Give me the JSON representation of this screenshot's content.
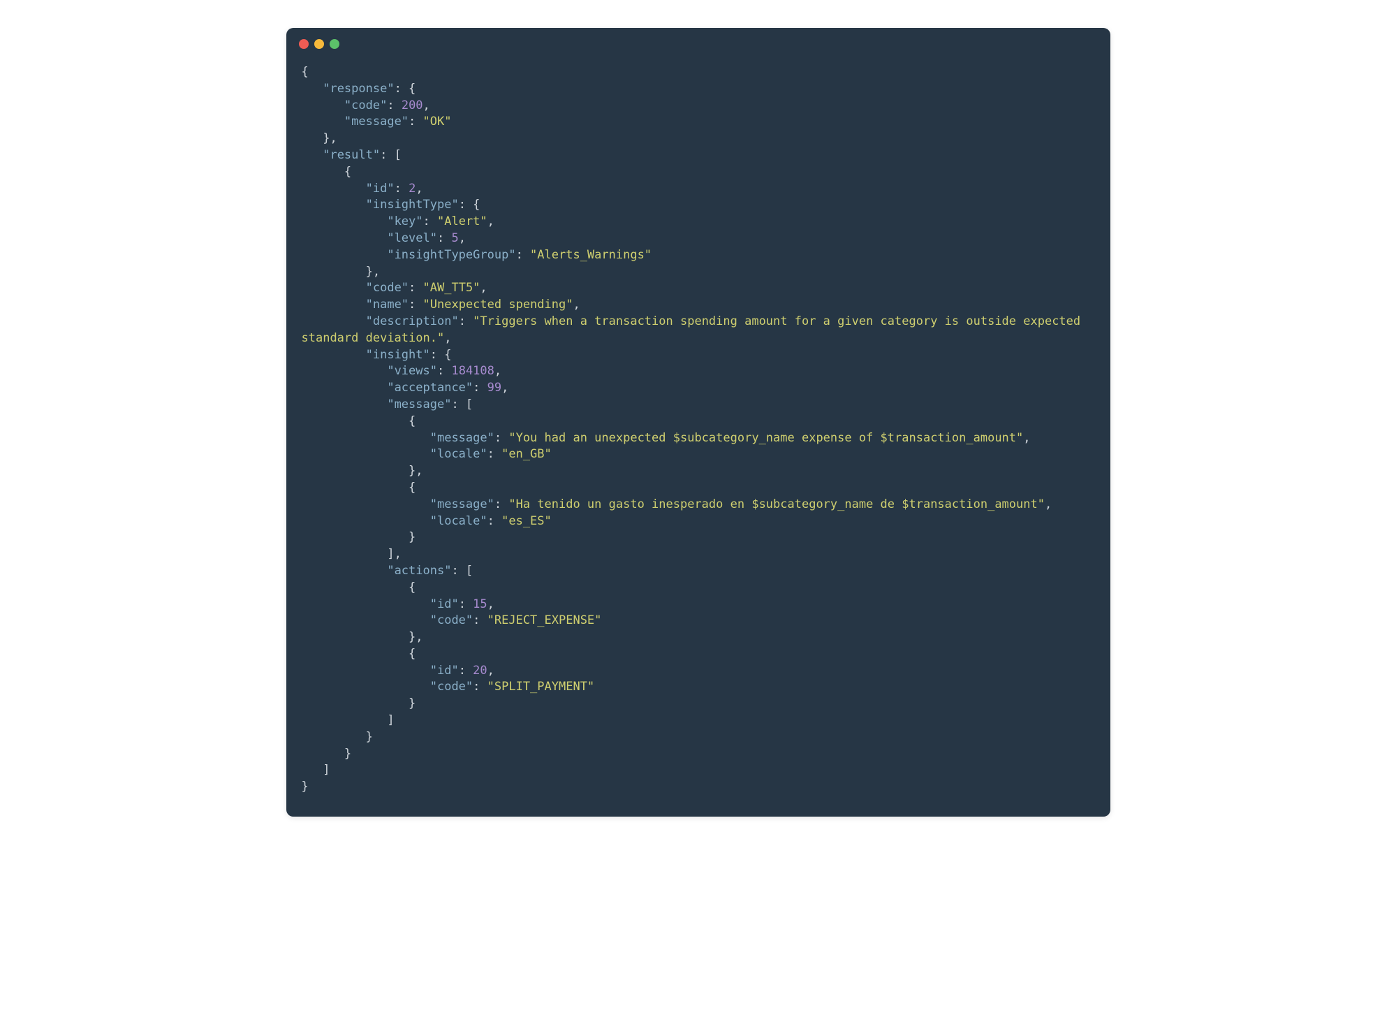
{
  "window": {
    "dots": [
      "red",
      "yellow",
      "green"
    ]
  },
  "json_payload": {
    "response": {
      "code": 200,
      "message": "OK"
    },
    "result": [
      {
        "id": 2,
        "insightType": {
          "key": "Alert",
          "level": 5,
          "insightTypeGroup": "Alerts_Warnings"
        },
        "code": "AW_TT5",
        "name": "Unexpected spending",
        "description": "Triggers when a transaction spending amount for a given category is outside expected standard deviation.",
        "insight": {
          "views": 184108,
          "acceptance": 99,
          "message": [
            {
              "message": "You had an unexpected $subcategory_name expense of $transaction_amount",
              "locale": "en_GB"
            },
            {
              "message": "Ha tenido un gasto inesperado en $subcategory_name de $transaction_amount",
              "locale": "es_ES"
            }
          ],
          "actions": [
            {
              "id": 15,
              "code": "REJECT_EXPENSE"
            },
            {
              "id": 20,
              "code": "SPLIT_PAYMENT"
            }
          ]
        }
      }
    ]
  },
  "lines": [
    [
      [
        "p",
        "{"
      ]
    ],
    [
      [
        "p",
        "   "
      ],
      [
        "k",
        "\"response\""
      ],
      [
        "p",
        ": {"
      ]
    ],
    [
      [
        "p",
        "      "
      ],
      [
        "k",
        "\"code\""
      ],
      [
        "p",
        ": "
      ],
      [
        "n",
        "200"
      ],
      [
        "p",
        ","
      ]
    ],
    [
      [
        "p",
        "      "
      ],
      [
        "k",
        "\"message\""
      ],
      [
        "p",
        ": "
      ],
      [
        "s",
        "\"OK\""
      ]
    ],
    [
      [
        "p",
        "   },"
      ]
    ],
    [
      [
        "p",
        "   "
      ],
      [
        "k",
        "\"result\""
      ],
      [
        "p",
        ": ["
      ]
    ],
    [
      [
        "p",
        "      {"
      ]
    ],
    [
      [
        "p",
        "         "
      ],
      [
        "k",
        "\"id\""
      ],
      [
        "p",
        ": "
      ],
      [
        "n",
        "2"
      ],
      [
        "p",
        ","
      ]
    ],
    [
      [
        "p",
        "         "
      ],
      [
        "k",
        "\"insightType\""
      ],
      [
        "p",
        ": {"
      ]
    ],
    [
      [
        "p",
        "            "
      ],
      [
        "k",
        "\"key\""
      ],
      [
        "p",
        ": "
      ],
      [
        "s",
        "\"Alert\""
      ],
      [
        "p",
        ","
      ]
    ],
    [
      [
        "p",
        "            "
      ],
      [
        "k",
        "\"level\""
      ],
      [
        "p",
        ": "
      ],
      [
        "n",
        "5"
      ],
      [
        "p",
        ","
      ]
    ],
    [
      [
        "p",
        "            "
      ],
      [
        "k",
        "\"insightTypeGroup\""
      ],
      [
        "p",
        ": "
      ],
      [
        "s",
        "\"Alerts_Warnings\""
      ]
    ],
    [
      [
        "p",
        "         },"
      ]
    ],
    [
      [
        "p",
        "         "
      ],
      [
        "k",
        "\"code\""
      ],
      [
        "p",
        ": "
      ],
      [
        "s",
        "\"AW_TT5\""
      ],
      [
        "p",
        ","
      ]
    ],
    [
      [
        "p",
        "         "
      ],
      [
        "k",
        "\"name\""
      ],
      [
        "p",
        ": "
      ],
      [
        "s",
        "\"Unexpected spending\""
      ],
      [
        "p",
        ","
      ]
    ],
    [
      [
        "p",
        "         "
      ],
      [
        "k",
        "\"description\""
      ],
      [
        "p",
        ": "
      ],
      [
        "s",
        "\"Triggers when a transaction spending amount for a given category is outside expected standard deviation.\""
      ],
      [
        "p",
        ","
      ]
    ],
    [
      [
        "p",
        "         "
      ],
      [
        "k",
        "\"insight\""
      ],
      [
        "p",
        ": {"
      ]
    ],
    [
      [
        "p",
        "            "
      ],
      [
        "k",
        "\"views\""
      ],
      [
        "p",
        ": "
      ],
      [
        "n",
        "184108"
      ],
      [
        "p",
        ","
      ]
    ],
    [
      [
        "p",
        "            "
      ],
      [
        "k",
        "\"acceptance\""
      ],
      [
        "p",
        ": "
      ],
      [
        "n",
        "99"
      ],
      [
        "p",
        ","
      ]
    ],
    [
      [
        "p",
        "            "
      ],
      [
        "k",
        "\"message\""
      ],
      [
        "p",
        ": ["
      ]
    ],
    [
      [
        "p",
        "               {"
      ]
    ],
    [
      [
        "p",
        "                  "
      ],
      [
        "k",
        "\"message\""
      ],
      [
        "p",
        ": "
      ],
      [
        "s",
        "\"You had an unexpected $subcategory_name expense of $transaction_amount\""
      ],
      [
        "p",
        ","
      ]
    ],
    [
      [
        "p",
        "                  "
      ],
      [
        "k",
        "\"locale\""
      ],
      [
        "p",
        ": "
      ],
      [
        "s",
        "\"en_GB\""
      ]
    ],
    [
      [
        "p",
        "               },"
      ]
    ],
    [
      [
        "p",
        "               {"
      ]
    ],
    [
      [
        "p",
        "                  "
      ],
      [
        "k",
        "\"message\""
      ],
      [
        "p",
        ": "
      ],
      [
        "s",
        "\"Ha tenido un gasto inesperado en $subcategory_name de $transaction_amount\""
      ],
      [
        "p",
        ","
      ]
    ],
    [
      [
        "p",
        "                  "
      ],
      [
        "k",
        "\"locale\""
      ],
      [
        "p",
        ": "
      ],
      [
        "s",
        "\"es_ES\""
      ]
    ],
    [
      [
        "p",
        "               }"
      ]
    ],
    [
      [
        "p",
        "            ],"
      ]
    ],
    [
      [
        "p",
        "            "
      ],
      [
        "k",
        "\"actions\""
      ],
      [
        "p",
        ": ["
      ]
    ],
    [
      [
        "p",
        "               {"
      ]
    ],
    [
      [
        "p",
        "                  "
      ],
      [
        "k",
        "\"id\""
      ],
      [
        "p",
        ": "
      ],
      [
        "n",
        "15"
      ],
      [
        "p",
        ","
      ]
    ],
    [
      [
        "p",
        "                  "
      ],
      [
        "k",
        "\"code\""
      ],
      [
        "p",
        ": "
      ],
      [
        "s",
        "\"REJECT_EXPENSE\""
      ]
    ],
    [
      [
        "p",
        "               },"
      ]
    ],
    [
      [
        "p",
        "               {"
      ]
    ],
    [
      [
        "p",
        "                  "
      ],
      [
        "k",
        "\"id\""
      ],
      [
        "p",
        ": "
      ],
      [
        "n",
        "20"
      ],
      [
        "p",
        ","
      ]
    ],
    [
      [
        "p",
        "                  "
      ],
      [
        "k",
        "\"code\""
      ],
      [
        "p",
        ": "
      ],
      [
        "s",
        "\"SPLIT_PAYMENT\""
      ]
    ],
    [
      [
        "p",
        "               }"
      ]
    ],
    [
      [
        "p",
        "            ]"
      ]
    ],
    [
      [
        "p",
        "         }"
      ]
    ],
    [
      [
        "p",
        "      }"
      ]
    ],
    [
      [
        "p",
        "   ]"
      ]
    ],
    [
      [
        "p",
        "}"
      ]
    ]
  ]
}
